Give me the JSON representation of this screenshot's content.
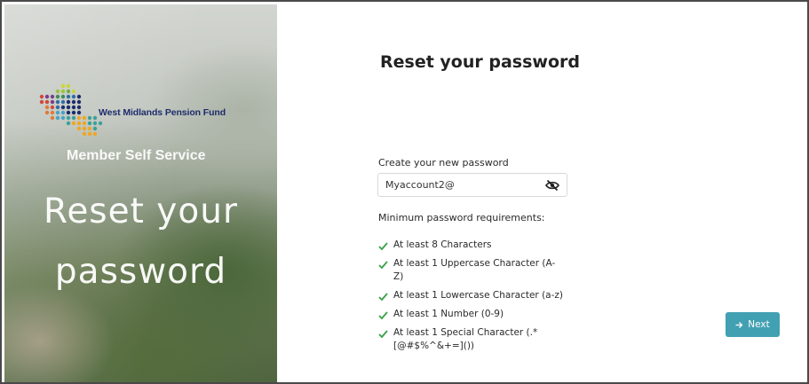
{
  "hero": {
    "org_name": "West Midlands Pension Fund",
    "subtitle": "Member Self Service",
    "title_line1": "Reset your",
    "title_line2": "password"
  },
  "form": {
    "title": "Reset your password",
    "password_label": "Create your new password",
    "password_value": "Myaccount2@",
    "requirements_heading": "Minimum password requirements:",
    "requirements": [
      {
        "text": "At least 8 Characters",
        "met": true
      },
      {
        "text": "At least 1 Uppercase Character (A-Z)",
        "met": true
      },
      {
        "text": "At least 1 Lowercase Character (a-z)",
        "met": true
      },
      {
        "text": "At least 1 Number (0-9)",
        "met": true
      },
      {
        "text": "At least 1 Special Character (.*[@#$%^&+=]())",
        "met": true
      }
    ],
    "next_label": "Next"
  },
  "icons": {
    "password_toggle": "eye-slash-icon",
    "check": "check-icon",
    "next": "arrow-right-icon"
  },
  "colors": {
    "check": "#3aa14a",
    "button": "#42a0b3",
    "logo_text": "#1d2c6b"
  }
}
